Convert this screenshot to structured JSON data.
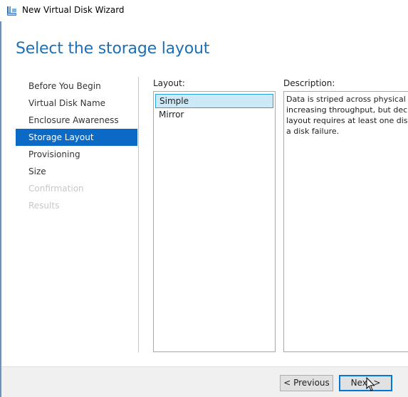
{
  "window": {
    "title": "New Virtual Disk Wizard",
    "icon": "virtual-disk-wizard-icon"
  },
  "page_title": "Select the storage layout",
  "nav": {
    "items": [
      {
        "label": "Before You Begin",
        "state": "normal"
      },
      {
        "label": "Virtual Disk Name",
        "state": "normal"
      },
      {
        "label": "Enclosure Awareness",
        "state": "normal"
      },
      {
        "label": "Storage Layout",
        "state": "selected"
      },
      {
        "label": "Provisioning",
        "state": "normal"
      },
      {
        "label": "Size",
        "state": "normal"
      },
      {
        "label": "Confirmation",
        "state": "disabled"
      },
      {
        "label": "Results",
        "state": "disabled"
      }
    ]
  },
  "layout": {
    "label": "Layout:",
    "options": [
      {
        "label": "Simple",
        "selected": true
      },
      {
        "label": "Mirror",
        "selected": false
      }
    ]
  },
  "description": {
    "label": "Description:",
    "text": "Data is striped across physical di\nincreasing throughput, but decre\nlayout requires at least one disk \na disk failure."
  },
  "buttons": {
    "previous": "< Previous",
    "next": "Next >"
  },
  "colors": {
    "accent": "#0a6ac6",
    "title": "#1f6fb2",
    "list_selection": "#cde8f7"
  }
}
